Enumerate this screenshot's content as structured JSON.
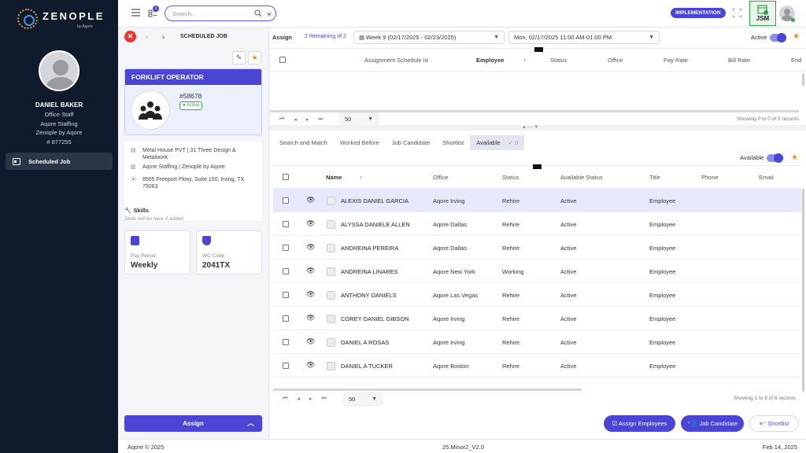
{
  "brand": {
    "name": "ZENOPLE",
    "sub": "by Aqore"
  },
  "profile": {
    "name": "DANIEL BAKER",
    "role": "Office Staff",
    "company": "Aqore Staffing",
    "org": "Zenople by Aqore",
    "id": "# 877255"
  },
  "sidebar": {
    "items": [
      {
        "label": "Scheduled Job"
      }
    ]
  },
  "topbar": {
    "search_placeholder": "Search...",
    "notification_count": "1",
    "environment_badge": "IMPLEMENTATION",
    "app_badge": "JSM"
  },
  "job": {
    "header": "SCHEDULED JOB",
    "title": "FORKLIFT OPERATOR",
    "number": "#58678",
    "status": "Active",
    "site": "Metal House PVT | 31 Three Design & Metalwork",
    "company": "Aqore Staffing | Zenople by Aqore",
    "address": "8505 Freeport Pkwy, Suite 150, Irving, TX 75063",
    "skills_title": "Skills",
    "skills_note": "Skills will be here if added",
    "pay_period_label": "Pay Period",
    "pay_period": "Weekly",
    "wc_code_label": "WC Code",
    "wc_code": "2041TX",
    "assign_label": "Assign"
  },
  "assign_bar": {
    "label": "Assign",
    "remaining": "2 Remaining of 2",
    "week": "Week 9 (02/17/2025 - 02/23/2025)",
    "shift": "Mon, 02/17/2025 11:00 AM-01:00 PM",
    "active_label": "Active"
  },
  "assign_table": {
    "columns": [
      "Assignment Schedule Id",
      "Employee",
      "Status",
      "Office",
      "Pay Rate",
      "Bill Rate",
      "End"
    ],
    "page_size": "50",
    "summary": "Showing 0 to 0 of 0 records"
  },
  "tabs": [
    {
      "label": "Search and Match"
    },
    {
      "label": "Worked Before"
    },
    {
      "label": "Job Candidate"
    },
    {
      "label": "Shortlist"
    },
    {
      "label": "Available",
      "count": "0"
    }
  ],
  "available_label": "Available",
  "candidates": {
    "columns": [
      "Name",
      "Office",
      "Status",
      "Available Status",
      "Title",
      "Phone",
      "Email"
    ],
    "rows": [
      {
        "name": "ALEXIS DANIEL GARCIA",
        "office": "Aqore Irving",
        "status": "Rehire",
        "available": "Active",
        "title": "Employee"
      },
      {
        "name": "ALYSSA DANIELE ALLEN",
        "office": "Aqore Dallas",
        "status": "Rehire",
        "available": "Active",
        "title": "Employee"
      },
      {
        "name": "ANDREINA PEREIRA",
        "office": "Aqore Dallas",
        "status": "Rehire",
        "available": "Active",
        "title": "Employee"
      },
      {
        "name": "ANDREINA LINARES",
        "office": "Aqore New York",
        "status": "Working",
        "available": "Active",
        "title": "Employee"
      },
      {
        "name": "ANTHONY DANIELS",
        "office": "Aqore Las Vegas",
        "status": "Rehire",
        "available": "Active",
        "title": "Employee"
      },
      {
        "name": "COREY DANIEL GIBSON",
        "office": "Aqore Irving",
        "status": "Rehire",
        "available": "Active",
        "title": "Employee"
      },
      {
        "name": "DANIEL A ROSAS",
        "office": "Aqore Irving",
        "status": "Rehire",
        "available": "Active",
        "title": "Employee"
      },
      {
        "name": "DANIEL A TUCKER",
        "office": "Aqore Boston",
        "status": "Rehire",
        "available": "Active",
        "title": "Employee"
      }
    ],
    "page_size": "50",
    "summary": "Showing 1 to 8 of 8 records"
  },
  "actions": {
    "assign_employees": "Assign Employees",
    "job_candidate": "Job Candidate",
    "shortlist": "Shortlist"
  },
  "footer": {
    "copyright": "Aqore © 2025",
    "version": "25.Minor2_V2.0",
    "date": "Feb 14, 2025"
  },
  "colors": {
    "primary": "#4b45d6",
    "sidebar_bg": "#0f1b2d",
    "danger": "#e53935",
    "success": "#35a853",
    "star": "#f28c1c"
  }
}
